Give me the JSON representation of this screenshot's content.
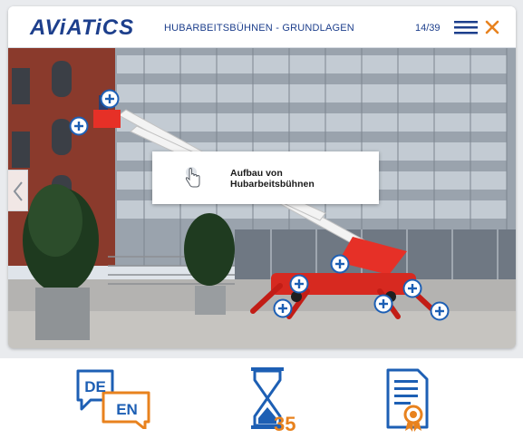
{
  "header": {
    "logo": "AViATiCS",
    "course_title": "HUBARBEITSBÜHNEN - GRUNDLAGEN",
    "page_counter": "14/39"
  },
  "icons": {
    "menu": "hamburger-menu-icon",
    "close": "close-icon",
    "prev": "chevron-left-icon",
    "hotspot": "plus-icon",
    "pointer": "hand-pointer-icon",
    "language": "language-de-en-icon",
    "timer": "hourglass-icon",
    "certificate": "certificate-icon"
  },
  "info_card": {
    "line1": "Aufbau von",
    "line2": "Hubarbeitsbühnen"
  },
  "tools": {
    "language_de": "DE",
    "language_en": "EN",
    "timer_minutes": "35"
  },
  "colors": {
    "brand_blue": "#1d3f8c",
    "accent_orange": "#e8821e",
    "hotspot_blue": "#1d5fb4"
  }
}
